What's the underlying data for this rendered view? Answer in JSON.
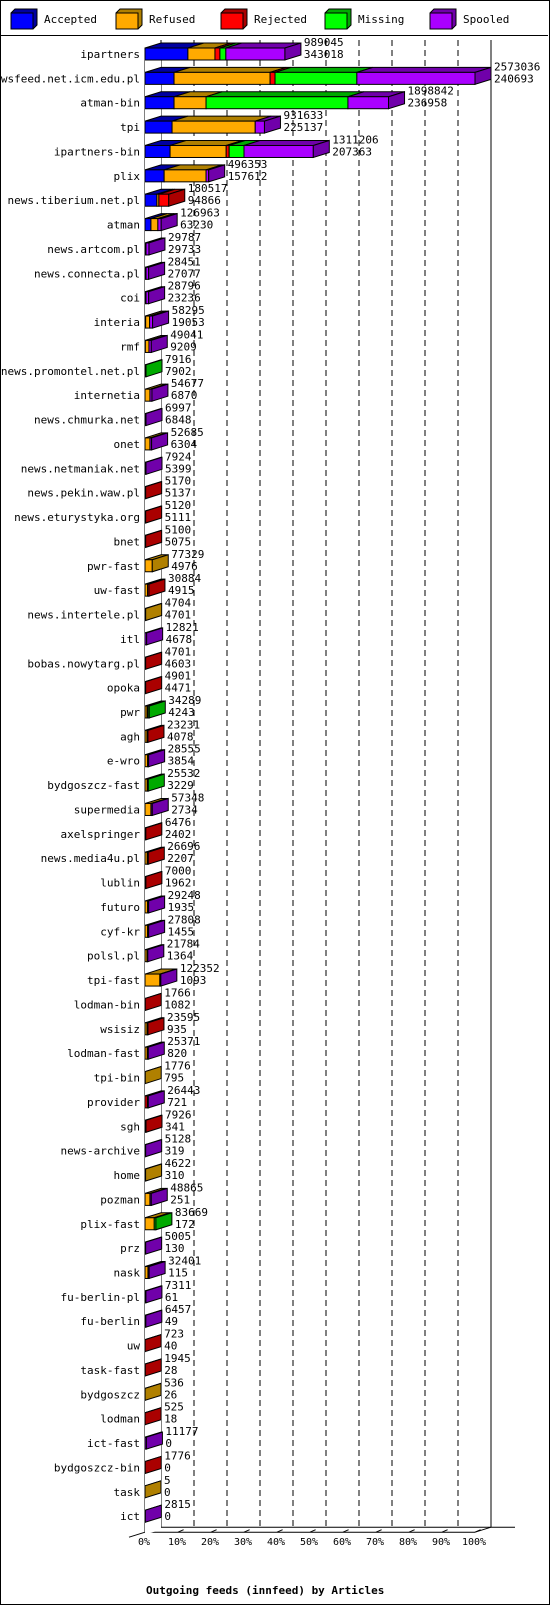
{
  "chart_data": {
    "type": "bar",
    "orientation": "horizontal",
    "stacked": true,
    "style": "3d",
    "title": "Outgoing feeds (innfeed) by Articles",
    "xlabel": "Outgoing feeds (innfeed) by Articles",
    "ylabel": "",
    "xlim": [
      0,
      100
    ],
    "x_ticks": [
      "0%",
      "10%",
      "20%",
      "30%",
      "40%",
      "50%",
      "60%",
      "70%",
      "80%",
      "90%",
      "100%"
    ],
    "grid": true,
    "legend_position": "top",
    "legend": [
      {
        "name": "Accepted",
        "color": "#0000ff",
        "dark": "#0000a0"
      },
      {
        "name": "Refused",
        "color": "#ffaa00",
        "dark": "#b08000"
      },
      {
        "name": "Rejected",
        "color": "#ff0000",
        "dark": "#aa0000"
      },
      {
        "name": "Missing",
        "color": "#00ff00",
        "dark": "#00aa00"
      },
      {
        "name": "Spooled",
        "color": "#aa00ff",
        "dark": "#7000aa"
      }
    ],
    "segment_units": "percent of largest feed total",
    "feeds": [
      {
        "name": "ipartners",
        "total": "989045",
        "second": "343018",
        "segments": [
          13.0,
          8.2,
          1.5,
          1.8,
          17.9
        ]
      },
      {
        "name": "newsfeed.net.icm.edu.pl",
        "total": "2573036",
        "second": "240693",
        "segments": [
          8.8,
          29.1,
          1.5,
          24.8,
          35.8
        ]
      },
      {
        "name": "atman-bin",
        "total": "1898842",
        "second": "236958",
        "segments": [
          8.8,
          9.7,
          0,
          43.0,
          12.3
        ]
      },
      {
        "name": "tpi",
        "total": "931633",
        "second": "225137",
        "segments": [
          8.2,
          25.2,
          0,
          0,
          2.8
        ]
      },
      {
        "name": "ipartners-bin",
        "total": "1311206",
        "second": "207363",
        "segments": [
          7.6,
          17.0,
          0.9,
          4.5,
          21.0
        ]
      },
      {
        "name": "plix",
        "total": "496353",
        "second": "157612",
        "segments": [
          5.8,
          12.7,
          0,
          0,
          0.8
        ]
      },
      {
        "name": "news.tiberium.net.pl",
        "total": "180517",
        "second": "94866",
        "segments": [
          3.6,
          0.6,
          3.0,
          0,
          0
        ]
      },
      {
        "name": "atman",
        "total": "126963",
        "second": "63230",
        "segments": [
          1.8,
          2.1,
          0,
          0,
          1.0
        ]
      },
      {
        "name": "news.artcom.pl",
        "total": "29787",
        "second": "29733",
        "segments": [
          0.3,
          0,
          0,
          0,
          0.9
        ]
      },
      {
        "name": "news.connecta.pl",
        "total": "28451",
        "second": "27077",
        "segments": [
          0.3,
          0,
          0,
          0,
          0.8
        ]
      },
      {
        "name": "coi",
        "total": "28796",
        "second": "23236",
        "segments": [
          0.3,
          0,
          0,
          0,
          0.8
        ]
      },
      {
        "name": "interia",
        "total": "58295",
        "second": "19053",
        "segments": [
          0.2,
          1.2,
          0,
          0,
          0.9
        ]
      },
      {
        "name": "rmf",
        "total": "49041",
        "second": "9209",
        "segments": [
          0.1,
          1.1,
          0,
          0,
          0.7
        ]
      },
      {
        "name": "news.promontel.net.pl",
        "total": "7916",
        "second": "7902",
        "segments": [
          0,
          0,
          0,
          0.3,
          0
        ]
      },
      {
        "name": "internetia",
        "total": "54677",
        "second": "6870",
        "segments": [
          0,
          1.5,
          0,
          0,
          0.6
        ]
      },
      {
        "name": "news.chmurka.net",
        "total": "6997",
        "second": "6848",
        "segments": [
          0,
          0,
          0,
          0,
          0.3
        ]
      },
      {
        "name": "onet",
        "total": "52685",
        "second": "6304",
        "segments": [
          0,
          1.5,
          0,
          0,
          0.5
        ]
      },
      {
        "name": "news.netmaniak.net",
        "total": "7924",
        "second": "5399",
        "segments": [
          0,
          0,
          0,
          0,
          0.3
        ]
      },
      {
        "name": "news.pekin.waw.pl",
        "total": "5170",
        "second": "5137",
        "segments": [
          0,
          0,
          0.2,
          0,
          0
        ]
      },
      {
        "name": "news.eturystyka.org",
        "total": "5120",
        "second": "5111",
        "segments": [
          0,
          0,
          0.2,
          0,
          0
        ]
      },
      {
        "name": "bnet",
        "total": "5100",
        "second": "5075",
        "segments": [
          0,
          0,
          0.2,
          0,
          0
        ]
      },
      {
        "name": "pwr-fast",
        "total": "77329",
        "second": "4976",
        "segments": [
          0,
          2.2,
          0,
          0,
          0
        ]
      },
      {
        "name": "uw-fast",
        "total": "30884",
        "second": "4915",
        "segments": [
          0,
          0.8,
          0.4,
          0,
          0
        ]
      },
      {
        "name": "news.intertele.pl",
        "total": "4704",
        "second": "4701",
        "segments": [
          0,
          0.2,
          0,
          0,
          0
        ]
      },
      {
        "name": "itl",
        "total": "12821",
        "second": "4678",
        "segments": [
          0,
          0,
          0,
          0,
          0.5
        ]
      },
      {
        "name": "bobas.nowytarg.pl",
        "total": "4701",
        "second": "4603",
        "segments": [
          0,
          0,
          0.2,
          0,
          0
        ]
      },
      {
        "name": "opoka",
        "total": "4901",
        "second": "4471",
        "segments": [
          0,
          0,
          0.2,
          0,
          0
        ]
      },
      {
        "name": "pwr",
        "total": "34289",
        "second": "4243",
        "segments": [
          0,
          0.6,
          0.3,
          0.4,
          0
        ]
      },
      {
        "name": "agh",
        "total": "23231",
        "second": "4078",
        "segments": [
          0,
          0.6,
          0.3,
          0,
          0
        ]
      },
      {
        "name": "e-wro",
        "total": "28555",
        "second": "3854",
        "segments": [
          0,
          0.8,
          0,
          0,
          0.3
        ]
      },
      {
        "name": "bydgoszcz-fast",
        "total": "25532",
        "second": "3229",
        "segments": [
          0,
          0.7,
          0,
          0.3,
          0
        ]
      },
      {
        "name": "supermedia",
        "total": "57348",
        "second": "2734",
        "segments": [
          0,
          1.8,
          0,
          0,
          0.4
        ]
      },
      {
        "name": "axelspringer",
        "total": "6476",
        "second": "2402",
        "segments": [
          0,
          0,
          0.25,
          0,
          0
        ]
      },
      {
        "name": "news.media4u.pl",
        "total": "26696",
        "second": "2207",
        "segments": [
          0,
          0.7,
          0.3,
          0,
          0
        ]
      },
      {
        "name": "lublin",
        "total": "7000",
        "second": "1962",
        "segments": [
          0,
          0,
          0.27,
          0,
          0
        ]
      },
      {
        "name": "futuro",
        "total": "29248",
        "second": "1935",
        "segments": [
          0,
          0.8,
          0,
          0,
          0.3
        ]
      },
      {
        "name": "cyf-kr",
        "total": "27808",
        "second": "1455",
        "segments": [
          0,
          0.8,
          0,
          0,
          0.3
        ]
      },
      {
        "name": "polsl.pl",
        "total": "21784",
        "second": "1364",
        "segments": [
          0,
          0.6,
          0,
          0,
          0.25
        ]
      },
      {
        "name": "tpi-fast",
        "total": "122352",
        "second": "1093",
        "segments": [
          0,
          4.5,
          0,
          0,
          0.3
        ]
      },
      {
        "name": "lodman-bin",
        "total": "1766",
        "second": "1082",
        "segments": [
          0,
          0,
          0.07,
          0,
          0
        ]
      },
      {
        "name": "wsisiz",
        "total": "23595",
        "second": "935",
        "segments": [
          0,
          0.6,
          0.3,
          0,
          0
        ]
      },
      {
        "name": "lodman-fast",
        "total": "25371",
        "second": "820",
        "segments": [
          0,
          0.7,
          0,
          0,
          0.3
        ]
      },
      {
        "name": "tpi-bin",
        "total": "1776",
        "second": "795",
        "segments": [
          0,
          0.07,
          0,
          0,
          0
        ]
      },
      {
        "name": "provider",
        "total": "26443",
        "second": "721",
        "segments": [
          0,
          0,
          0.7,
          0,
          0.3
        ]
      },
      {
        "name": "sgh",
        "total": "7926",
        "second": "341",
        "segments": [
          0,
          0,
          0.3,
          0,
          0
        ]
      },
      {
        "name": "news-archive",
        "total": "5128",
        "second": "319",
        "segments": [
          0,
          0,
          0,
          0,
          0.2
        ]
      },
      {
        "name": "home",
        "total": "4622",
        "second": "310",
        "segments": [
          0,
          0.18,
          0,
          0,
          0
        ]
      },
      {
        "name": "pozman",
        "total": "48865",
        "second": "251",
        "segments": [
          0,
          1.5,
          0,
          0,
          0.4
        ]
      },
      {
        "name": "plix-fast",
        "total": "83669",
        "second": "172",
        "segments": [
          0,
          2.8,
          0,
          0.5,
          0
        ]
      },
      {
        "name": "prz",
        "total": "5005",
        "second": "130",
        "segments": [
          0,
          0,
          0,
          0,
          0.2
        ]
      },
      {
        "name": "nask",
        "total": "32401",
        "second": "115",
        "segments": [
          0,
          0.9,
          0,
          0,
          0.35
        ]
      },
      {
        "name": "fu-berlin-pl",
        "total": "7311",
        "second": "61",
        "segments": [
          0,
          0,
          0,
          0,
          0.28
        ]
      },
      {
        "name": "fu-berlin",
        "total": "6457",
        "second": "49",
        "segments": [
          0,
          0,
          0,
          0,
          0.25
        ]
      },
      {
        "name": "uw",
        "total": "723",
        "second": "40",
        "segments": [
          0,
          0,
          0.03,
          0,
          0
        ]
      },
      {
        "name": "task-fast",
        "total": "1945",
        "second": "28",
        "segments": [
          0,
          0,
          0.08,
          0,
          0
        ]
      },
      {
        "name": "bydgoszcz",
        "total": "536",
        "second": "26",
        "segments": [
          0,
          0.02,
          0,
          0,
          0
        ]
      },
      {
        "name": "lodman",
        "total": "525",
        "second": "18",
        "segments": [
          0,
          0,
          0.02,
          0,
          0
        ]
      },
      {
        "name": "ict-fast",
        "total": "11177",
        "second": "0",
        "segments": [
          0,
          0,
          0,
          0,
          0.43
        ]
      },
      {
        "name": "bydgoszcz-bin",
        "total": "1776",
        "second": "0",
        "segments": [
          0,
          0,
          0.07,
          0,
          0
        ]
      },
      {
        "name": "task",
        "total": "5",
        "second": "0",
        "segments": [
          0,
          0.0002,
          0,
          0,
          0
        ]
      },
      {
        "name": "ict",
        "total": "2815",
        "second": "0",
        "segments": [
          0,
          0,
          0,
          0,
          0.11
        ]
      }
    ]
  }
}
